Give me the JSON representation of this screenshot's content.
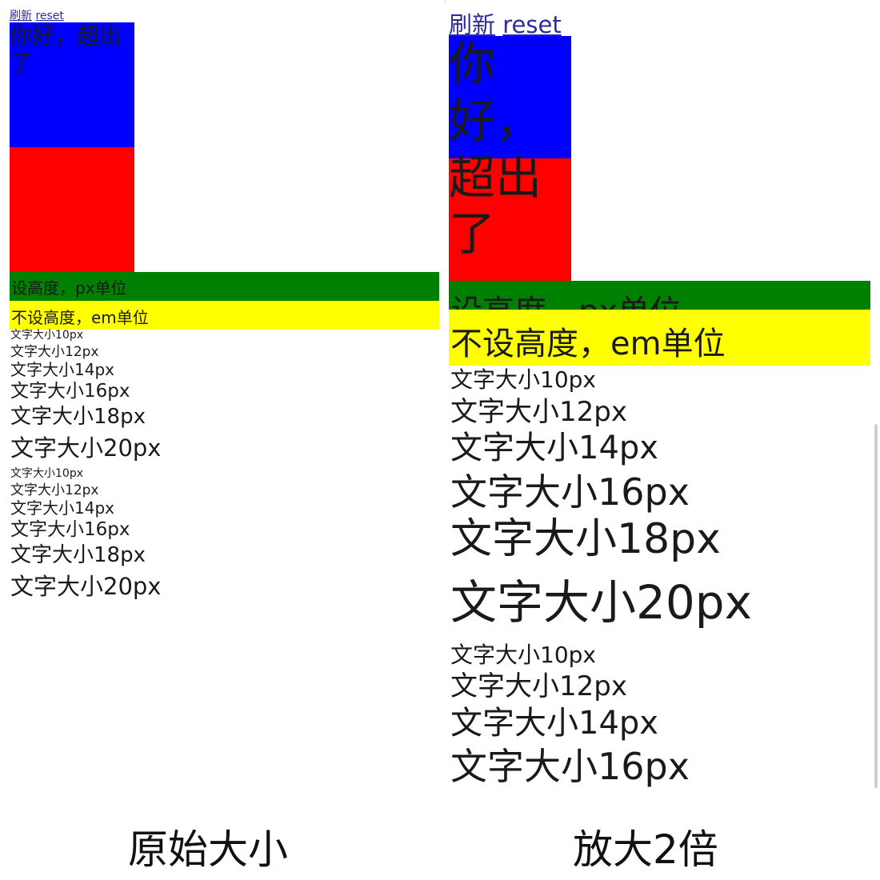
{
  "links": {
    "refresh": "刷新",
    "reset": "reset"
  },
  "boxes": {
    "overflow_text": "你好，超出了",
    "blue": "#0000ff",
    "red": "#ff0000"
  },
  "bars": {
    "fixed_height": {
      "label": "设高度，px单位",
      "color": "#008000"
    },
    "auto_height": {
      "label": "不设高度，em单位",
      "color": "#ffff00"
    }
  },
  "font_samples": {
    "group1": [
      "文字大小10px",
      "文字大小12px",
      "文字大小14px",
      "文字大小16px",
      "文字大小18px",
      "文字大小20px"
    ],
    "group2": [
      "文字大小10px",
      "文字大小12px",
      "文字大小14px",
      "文字大小16px",
      "文字大小18px",
      "文字大小20px"
    ]
  },
  "right_group2_visible": [
    "文字大小10px",
    "文字大小12px",
    "文字大小14px",
    "文字大小16px"
  ],
  "captions": {
    "left": "原始大小",
    "right": "放大2倍"
  }
}
